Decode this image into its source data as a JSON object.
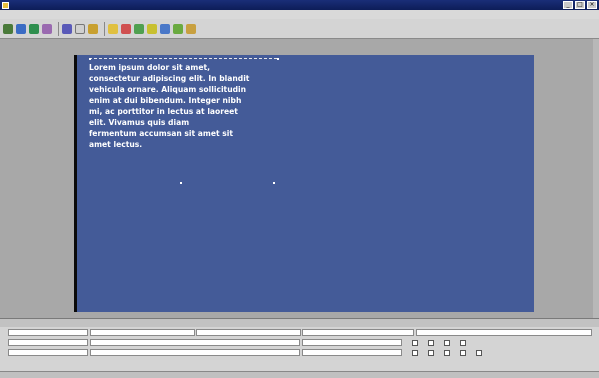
{
  "window": {
    "title": ""
  },
  "menu": {
    "items": [
      "",
      "",
      "",
      "",
      "",
      ""
    ]
  },
  "toolbar": {
    "text": ""
  },
  "slide": {
    "text": "Lorem ipsum dolor sit amet,\nconsectetur adipiscing elit. In blandit\nvehicula ornare. Aliquam sollicitudin\nenim at dui bibendum. Integer nibh\nmi, ac porttitor in lectus at laoreet\nelit. Vivamus quis diam\nfermentum accumsan sit amet sit\namet lectus."
  },
  "panel": {
    "title": ""
  },
  "colors": {
    "slide_bg": "#445b98",
    "workspace": "#a8a8a8",
    "titlebar": "#1a2e78"
  }
}
